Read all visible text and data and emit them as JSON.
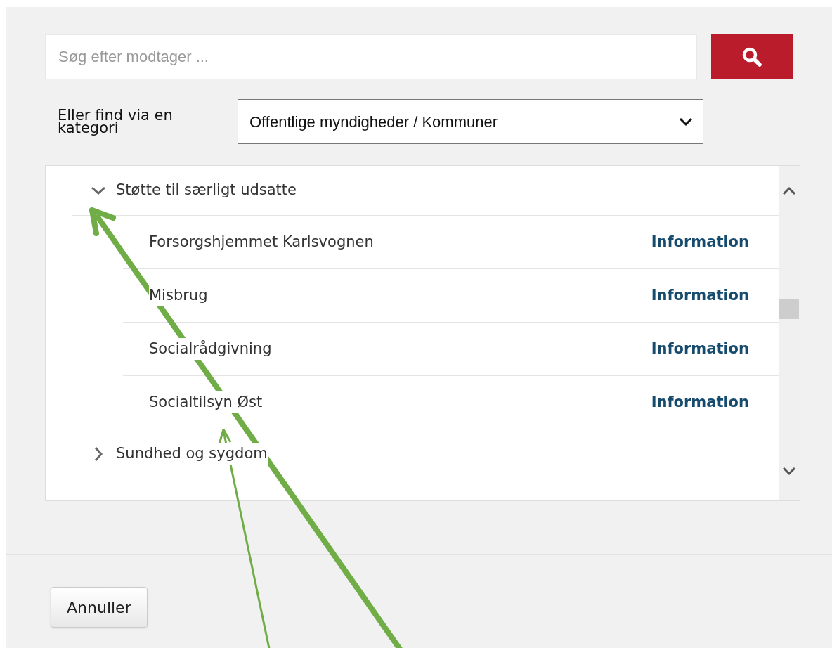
{
  "search": {
    "placeholder": "Søg efter modtager ..."
  },
  "category_label": "Eller find via en kategori",
  "category_select": {
    "value": "Offentlige myndigheder / Kommuner"
  },
  "tree": [
    {
      "label": "Støtte til særligt udsatte",
      "expanded": true,
      "children": [
        {
          "label": "Forsorgshjemmet Karlsvognen",
          "link": "Information"
        },
        {
          "label": "Misbrug",
          "link": "Information"
        },
        {
          "label": "Socialrådgivning",
          "link": "Information"
        },
        {
          "label": "Socialtilsyn Øst",
          "link": "Information"
        }
      ]
    },
    {
      "label": "Sundhed og sygdom",
      "expanded": false
    }
  ],
  "buttons": [
    "Annuller"
  ]
}
